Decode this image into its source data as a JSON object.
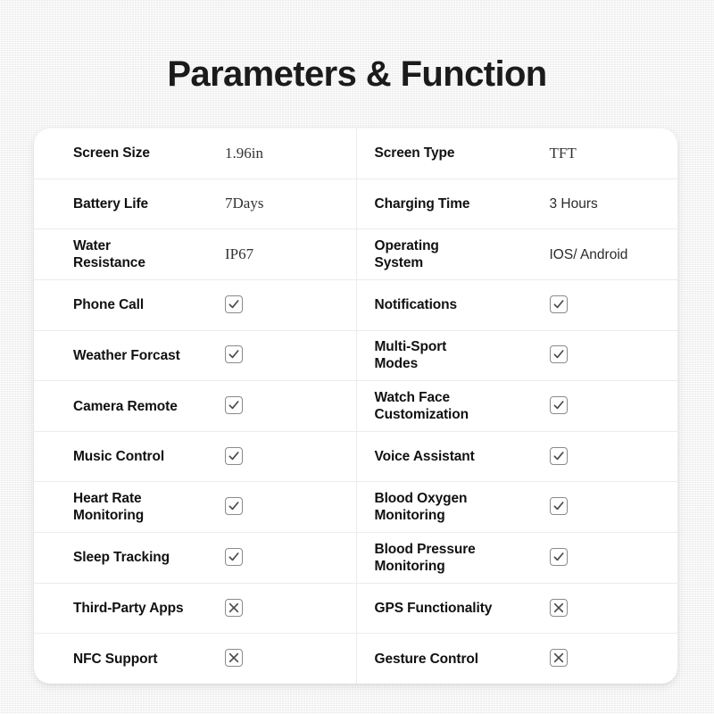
{
  "page": {
    "title": "Parameters & Function",
    "background_color": "#f2f2f2",
    "card_background": "#ffffff"
  },
  "icons": {
    "checked": "checkbox-checked-icon",
    "unchecked": "checkbox-cross-icon"
  },
  "table": {
    "rows": [
      {
        "left": {
          "label": "Screen Size",
          "value": "1.96in",
          "type": "text-serif"
        },
        "right": {
          "label": "Screen Type",
          "value": "TFT",
          "type": "text-serif"
        }
      },
      {
        "left": {
          "label": "Battery Life",
          "value": "7Days",
          "type": "text-serif"
        },
        "right": {
          "label": "Charging Time",
          "value": "3 Hours",
          "type": "text"
        }
      },
      {
        "left": {
          "label": "Water\nResistance",
          "value": "IP67",
          "type": "text-serif"
        },
        "right": {
          "label": "Operating\nSystem",
          "value": "IOS/ Android",
          "type": "text"
        }
      },
      {
        "left": {
          "label": "Phone Call",
          "value": "checked",
          "type": "mark"
        },
        "right": {
          "label": "Notifications",
          "value": "checked",
          "type": "mark"
        }
      },
      {
        "left": {
          "label": "Weather Forcast",
          "value": "checked",
          "type": "mark"
        },
        "right": {
          "label": "Multi-Sport\nModes",
          "value": "checked",
          "type": "mark"
        }
      },
      {
        "left": {
          "label": "Camera Remote",
          "value": "checked",
          "type": "mark"
        },
        "right": {
          "label": "Watch Face\nCustomization",
          "value": "checked",
          "type": "mark"
        }
      },
      {
        "left": {
          "label": "Music Control",
          "value": "checked",
          "type": "mark"
        },
        "right": {
          "label": "Voice Assistant",
          "value": "checked",
          "type": "mark"
        }
      },
      {
        "left": {
          "label": "Heart Rate\nMonitoring",
          "value": "checked",
          "type": "mark"
        },
        "right": {
          "label": "Blood Oxygen\nMonitoring",
          "value": "checked",
          "type": "mark"
        }
      },
      {
        "left": {
          "label": "Sleep Tracking",
          "value": "checked",
          "type": "mark"
        },
        "right": {
          "label": "Blood Pressure\nMonitoring",
          "value": "checked",
          "type": "mark"
        }
      },
      {
        "left": {
          "label": "Third-Party Apps",
          "value": "unchecked",
          "type": "mark"
        },
        "right": {
          "label": "GPS Functionality",
          "value": "unchecked",
          "type": "mark"
        }
      },
      {
        "left": {
          "label": "NFC Support",
          "value": "unchecked",
          "type": "mark"
        },
        "right": {
          "label": "Gesture Control",
          "value": "unchecked",
          "type": "mark"
        }
      }
    ]
  }
}
